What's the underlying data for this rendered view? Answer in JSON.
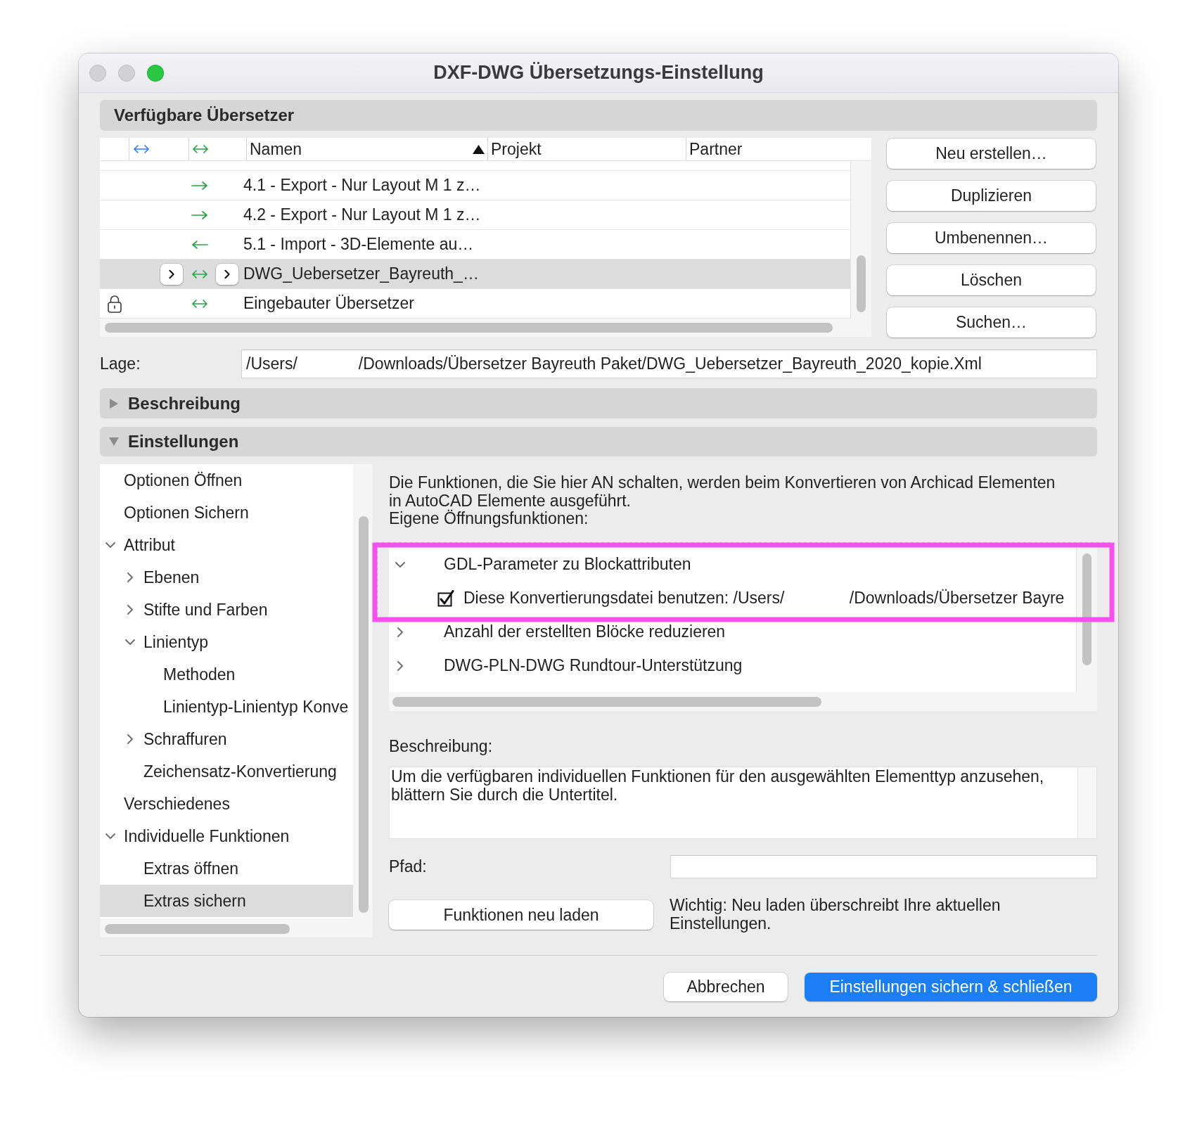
{
  "window": {
    "title": "DXF-DWG Übersetzungs-Einstellung",
    "controls": [
      {
        "kind": "close",
        "enabled": false
      },
      {
        "kind": "minimize",
        "enabled": false
      },
      {
        "kind": "zoom",
        "enabled": true
      }
    ]
  },
  "translators": {
    "title": "Verfügbare Übersetzer",
    "columns": [
      {
        "label": "Namen",
        "sorted": true
      },
      {
        "label": "Projekt",
        "sorted": false
      },
      {
        "label": "Partner",
        "sorted": false
      }
    ],
    "rows": [
      {
        "name": "4.1 - Export - Nur Layout M 1 z…",
        "kind": "export",
        "locked": false,
        "selected": false
      },
      {
        "name": "4.2 - Export - Nur Layout M 1 z…",
        "kind": "export",
        "locked": false,
        "selected": false
      },
      {
        "name": "5.1 - Import - 3D-Elemente au…",
        "kind": "import",
        "locked": false,
        "selected": false
      },
      {
        "name": "DWG_Uebersetzer_Bayreuth_…",
        "kind": "both",
        "locked": false,
        "selected": true
      },
      {
        "name": "Eingebauter Übersetzer",
        "kind": "both",
        "locked": true,
        "selected": false
      }
    ],
    "buttons": [
      "Neu erstellen…",
      "Duplizieren",
      "Umbenennen…",
      "Löschen",
      "Suchen…"
    ]
  },
  "location": {
    "label": "Lage:",
    "value_parts": [
      "/Users/",
      "/Downloads/Übersetzer Bayreuth Paket/DWG_Uebersetzer_Bayreuth_2020_kopie.Xml"
    ]
  },
  "sections": [
    {
      "title": "Beschreibung",
      "expanded": false
    },
    {
      "title": "Einstellungen",
      "expanded": true
    }
  ],
  "settings": {
    "tree": [
      {
        "label": "Optionen Öffnen",
        "selected": false
      },
      {
        "label": "Optionen Sichern",
        "selected": false
      },
      {
        "label": "Attribut",
        "selected": false,
        "expanded": true,
        "children": [
          {
            "label": "Ebenen",
            "selected": false,
            "expanded": false
          },
          {
            "label": "Stifte und Farben",
            "selected": false,
            "expanded": false
          },
          {
            "label": "Linientyp",
            "selected": false,
            "expanded": true,
            "children": [
              {
                "label": "Methoden",
                "selected": false
              },
              {
                "label": "Linientyp-Linientyp Konve",
                "selected": false
              }
            ]
          },
          {
            "label": "Schraffuren",
            "selected": false,
            "expanded": false
          },
          {
            "label": "Zeichensatz-Konvertierung",
            "selected": false
          }
        ]
      },
      {
        "label": "Verschiedenes",
        "selected": false
      },
      {
        "label": "Individuelle Funktionen",
        "selected": false,
        "expanded": true,
        "children": [
          {
            "label": "Extras öffnen",
            "selected": false
          },
          {
            "label": "Extras sichern",
            "selected": true
          }
        ]
      }
    ],
    "intro": "Die Funktionen, die Sie hier AN schalten, werden beim Konvertieren von Archicad Elementen in AutoCAD Elemente ausgeführt.",
    "list_label": "Eigene Öffnungsfunktionen:",
    "functions": [
      {
        "label": "GDL-Parameter zu Blockattributen",
        "expanded": true,
        "children": [
          {
            "kind": "checkbox",
            "checked": true,
            "label_parts": [
              "Diese Konvertierungsdatei benutzen: /Users/",
              "/Downloads/Übersetzer Bayre"
            ]
          }
        ]
      },
      {
        "label": "Anzahl der erstellten Blöcke reduzieren",
        "expanded": false
      },
      {
        "label": "DWG-PLN-DWG Rundtour-Unterstützung",
        "expanded": false
      }
    ],
    "description": {
      "label": "Beschreibung:",
      "text": "Um die verfügbaren individuellen Funktionen für den ausgewählten Elementtyp anzusehen, blättern Sie durch die Untertitel."
    },
    "path": {
      "label": "Pfad:"
    },
    "reload_button": "Funktionen neu laden",
    "note": "Wichtig: Neu laden überschreibt Ihre aktuellen Einstellungen."
  },
  "footer": {
    "buttons": [
      {
        "label": "Abbrechen",
        "kind": "secondary"
      },
      {
        "label": "Einstellungen sichern & schließen",
        "kind": "primary"
      }
    ]
  }
}
